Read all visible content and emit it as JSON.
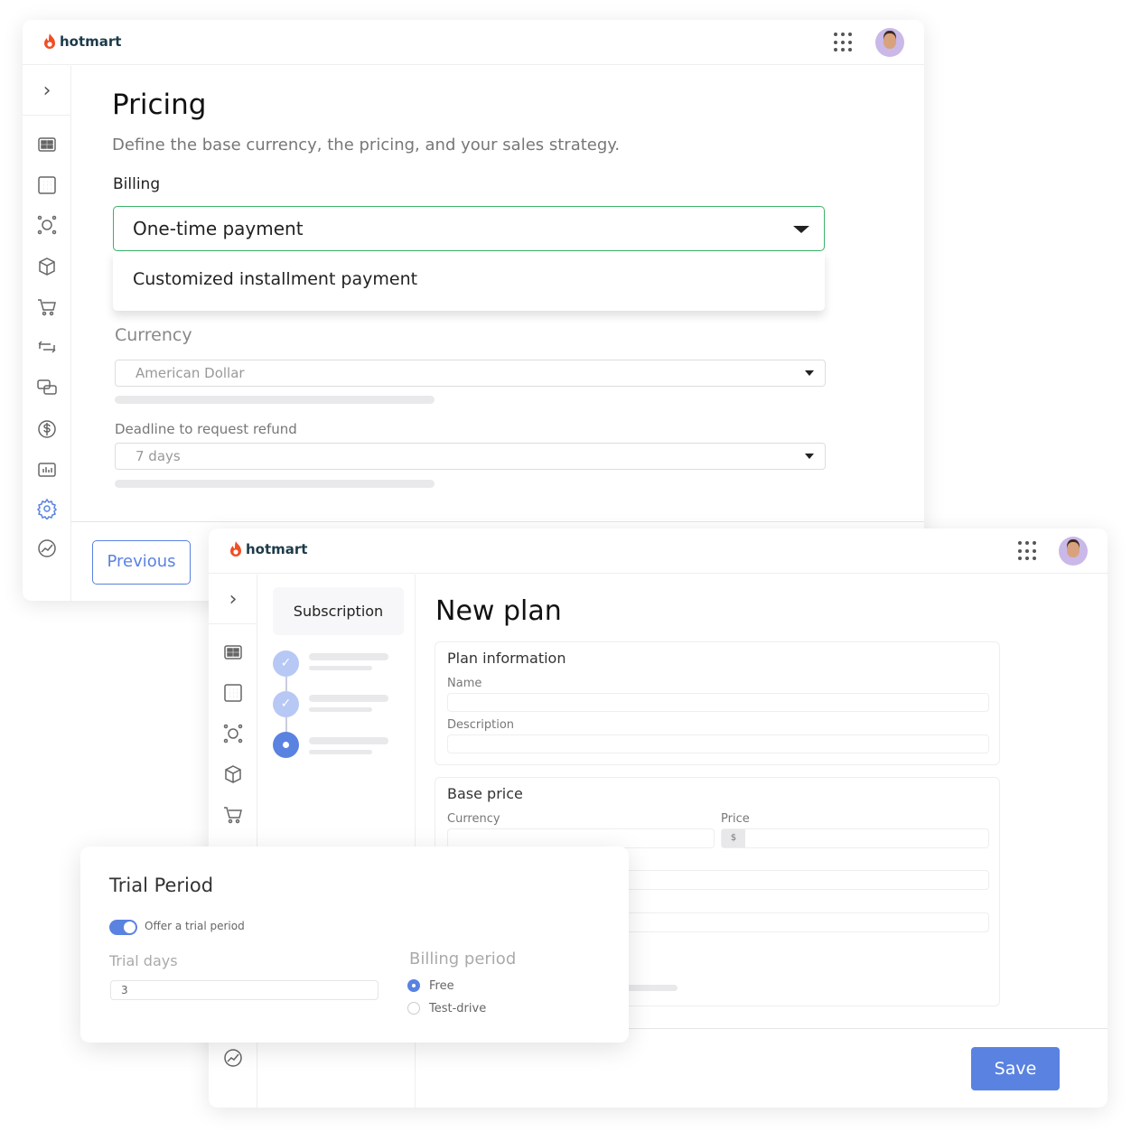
{
  "brand": "hotmart",
  "colors": {
    "accent": "#5a82e0",
    "focus_border": "#3db26b",
    "logo_orange": "#f04e23"
  },
  "pricing_window": {
    "title": "Pricing",
    "subtitle": "Define the base currency, the pricing, and your sales strategy.",
    "billing_label": "Billing",
    "billing_value": "One-time payment",
    "billing_options": [
      "Customized installment payment"
    ],
    "currency_label": "Currency",
    "currency_value": "American Dollar",
    "refund_label": "Deadline to request refund",
    "refund_value": "7 days",
    "previous_label": "Previous",
    "sidebar_icons": [
      "dashboard-icon",
      "apps-icon",
      "affiliate-network-icon",
      "product-box-icon",
      "cart-icon",
      "recurrence-icon",
      "chat-icon",
      "dollar-icon",
      "analytics-icon",
      "settings-icon",
      "growth-icon"
    ],
    "active_sidebar_icon": "settings-icon"
  },
  "plan_window": {
    "steps_title": "Subscription",
    "steps": [
      {
        "state": "done"
      },
      {
        "state": "done"
      },
      {
        "state": "current"
      }
    ],
    "title": "New plan",
    "plan_info": {
      "title": "Plan information",
      "name_label": "Name",
      "description_label": "Description"
    },
    "base_price": {
      "title": "Base price",
      "currency_label": "Currency",
      "price_label": "Price",
      "price_prefix": "$"
    },
    "save_label": "Save"
  },
  "trial_card": {
    "title": "Trial Period",
    "toggle_label": "Offer a trial period",
    "toggle_on": true,
    "trial_days_label": "Trial days",
    "trial_days_value": "3",
    "billing_period_label": "Billing period",
    "options": [
      {
        "label": "Free",
        "selected": true
      },
      {
        "label": "Test-drive",
        "selected": false
      }
    ]
  }
}
